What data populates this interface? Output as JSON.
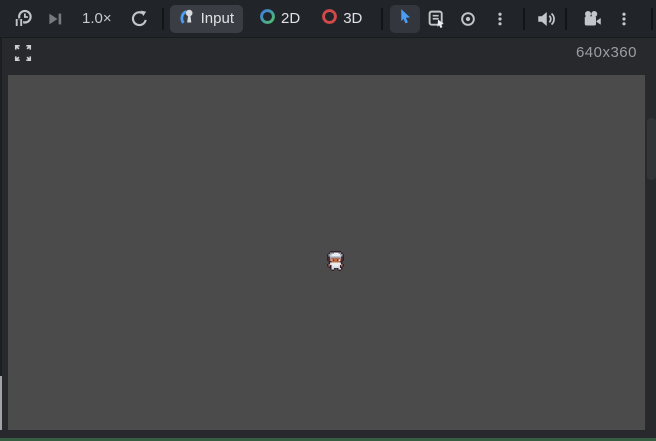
{
  "toolbar": {
    "speed_label": "1.0×",
    "input_label": "Input",
    "mode_2d_label": "2D",
    "mode_3d_label": "3D",
    "icons": [
      "suspend-icon",
      "next-frame-icon",
      "restart-icon",
      "joypad-icon",
      "ring-2d-icon",
      "ring-3d-icon",
      "select-cursor-icon",
      "select-list-icon",
      "focus-icon",
      "ellipsis-icon",
      "speaker-icon",
      "camera-icon"
    ]
  },
  "subbar": {
    "resolution": "640x360"
  },
  "colors": {
    "toolbar_bg": "#212529",
    "panel_bg": "#27292c",
    "viewport_bg": "#4b4b4b",
    "accent_blue": "#4b9cf5",
    "ring_2d_blue": "#3e7de0",
    "ring_2d_green": "#4fc06a",
    "ring_3d_red": "#d14949",
    "active_button_bg": "#3a3e44",
    "bottom_line_green": "#365c42"
  },
  "viewport": {
    "sprite": {
      "palette": {
        "o": "#33202a",
        "g": "#99a0ab",
        "w": "#e9edf2",
        "d": "#5c2b33",
        "t": "#bc6a42",
        "b": "#d4d9df"
      },
      "pixels": [
        "..oooooooo..",
        ".ogggwwwggo.",
        "oggwwwwwwggo",
        "ogwwwwwwwwgo",
        "odggggggggdo",
        "odgttttttgdo",
        "odtwdttdwtdo",
        ".odttttttdo.",
        ".obwwwwwwbo.",
        "otbwwwwwwbto",
        "otobwwwwboto",
        ".oobbbbbboo.",
        "..obbo.obbo.",
        "...oo...oo.."
      ]
    }
  }
}
